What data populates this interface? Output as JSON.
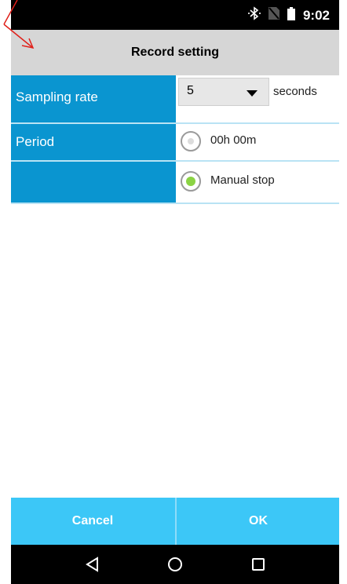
{
  "status_bar": {
    "time": "9:02",
    "icons": [
      "bluetooth-icon",
      "no-sim-icon",
      "battery-icon"
    ]
  },
  "header": {
    "title": "Record setting"
  },
  "form": {
    "sampling_rate": {
      "label": "Sampling rate",
      "value": "5",
      "unit": "seconds"
    },
    "period": {
      "label": "Period",
      "options": [
        {
          "label": "00h 00m",
          "selected": false
        },
        {
          "label": "Manual stop",
          "selected": true
        }
      ]
    }
  },
  "buttons": {
    "cancel": "Cancel",
    "ok": "OK"
  },
  "nav": [
    "back-icon",
    "home-icon",
    "recents-icon"
  ],
  "colors": {
    "label_bg": "#0a95d0",
    "button_bg": "#3cc7f7",
    "title_bg": "#d6d6d6",
    "selected_radio": "#8bd344",
    "annotation": "#e0201a"
  }
}
